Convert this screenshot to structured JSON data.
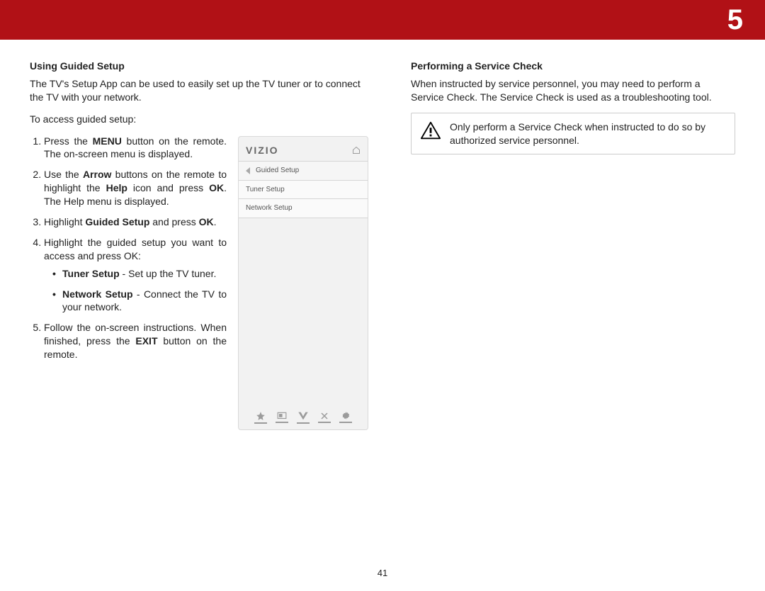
{
  "chapter_number": "5",
  "page_number": "41",
  "left": {
    "heading": "Using Guided Setup",
    "intro": "The TV's Setup App can be used to easily set up the TV tuner or to connect the TV with your network.",
    "lead": "To access guided setup:",
    "steps": {
      "s1a": "Press the ",
      "s1b": "MENU",
      "s1c": " button on the remote. The on-screen menu is displayed.",
      "s2a": "Use the ",
      "s2b": "Arrow",
      "s2c": " buttons on the remote to highlight the ",
      "s2d": "Help",
      "s2e": " icon and press ",
      "s2f": "OK",
      "s2g": ". The Help menu is displayed.",
      "s3a": "Highlight ",
      "s3b": "Guided Setup",
      "s3c": " and press ",
      "s3d": "OK",
      "s3e": ".",
      "s4": "Highlight the guided setup you want to access and press OK:",
      "s4_tuner_b": "Tuner Setup",
      "s4_tuner_t": " - Set up the TV tuner.",
      "s4_net_b": "Network Setup",
      "s4_net_t": " - Connect the TV to your network.",
      "s5a": "Follow the on-screen instructions. When finished, press the ",
      "s5b": "EXIT",
      "s5c": " button on the remote."
    },
    "device": {
      "logo": "VIZIO",
      "crumb": "Guided Setup",
      "rows": [
        "Tuner Setup",
        "Network Setup"
      ]
    }
  },
  "right": {
    "heading": "Performing a Service Check",
    "intro": "When instructed by service personnel, you may need to perform a Service Check. The Service Check is used as a troubleshooting tool.",
    "warning": "Only perform a Service Check when instructed to do so by authorized service personnel."
  }
}
